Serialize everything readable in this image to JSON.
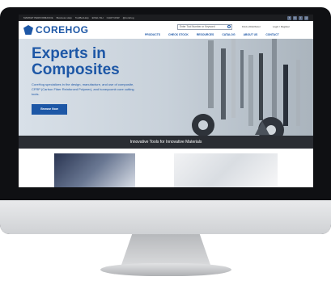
{
  "topbar": {
    "items": [
      "MARKET PERFORMANCE",
      "Business Help",
      "ToolBoxHelp",
      "ENGL ISH",
      "CHAT NOW",
      "@corehog"
    ],
    "social": [
      "f",
      "in",
      "t",
      "yt"
    ]
  },
  "header": {
    "logo_text": "COREHOG",
    "search_placeholder": "Enter Tool Number or Keyword",
    "find_distributor": "Find a Distributor",
    "login_register": "Login / Register",
    "nav": [
      "PRODUCTS",
      "CHECK STOCK",
      "RESOURCES",
      "CATALOG",
      "ABOUT US",
      "CONTACT"
    ]
  },
  "hero": {
    "title": "Experts in Composites",
    "description": "CoreHog specializes in the design, manufacture, and use of composite, CFRP (Carbon Fiber Reinforced Polymer), and honeycomb core cutting tools.",
    "button": "Browse Now"
  },
  "banner": {
    "text": "Innovative Tools for Innovative Materials"
  }
}
